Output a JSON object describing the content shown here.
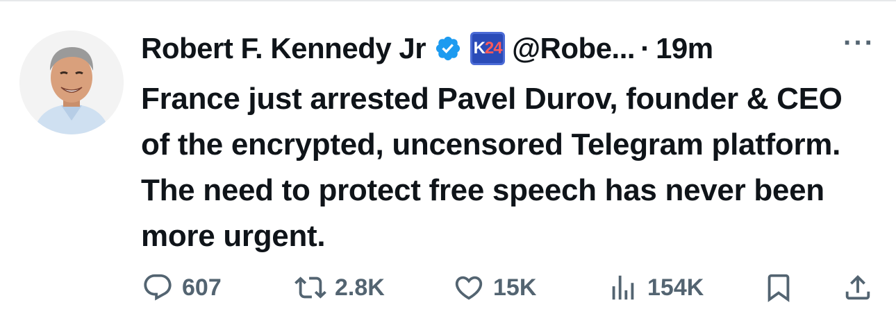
{
  "tweet": {
    "author_name": "Robert F. Kennedy Jr",
    "badge_text_a": "K",
    "badge_text_b": "24",
    "handle": "@Robe...",
    "separator": "·",
    "time": "19m",
    "more": "···",
    "text": "France just arrested Pavel Durov, founder & CEO of the encrypted, uncensored Telegram platform. The need to protect free speech has never been more urgent."
  },
  "actions": {
    "replies": "607",
    "reposts": "2.8K",
    "likes": "15K",
    "views": "154K"
  },
  "colors": {
    "verified": "#1d9bf0",
    "badge_bg": "#2a4bb8",
    "muted": "#536471",
    "text": "#0f1419"
  },
  "icons": [
    "avatar-photo",
    "verified-icon",
    "affiliate-badge",
    "more-icon",
    "reply-icon",
    "repost-icon",
    "like-icon",
    "views-icon",
    "bookmark-icon",
    "share-icon"
  ]
}
